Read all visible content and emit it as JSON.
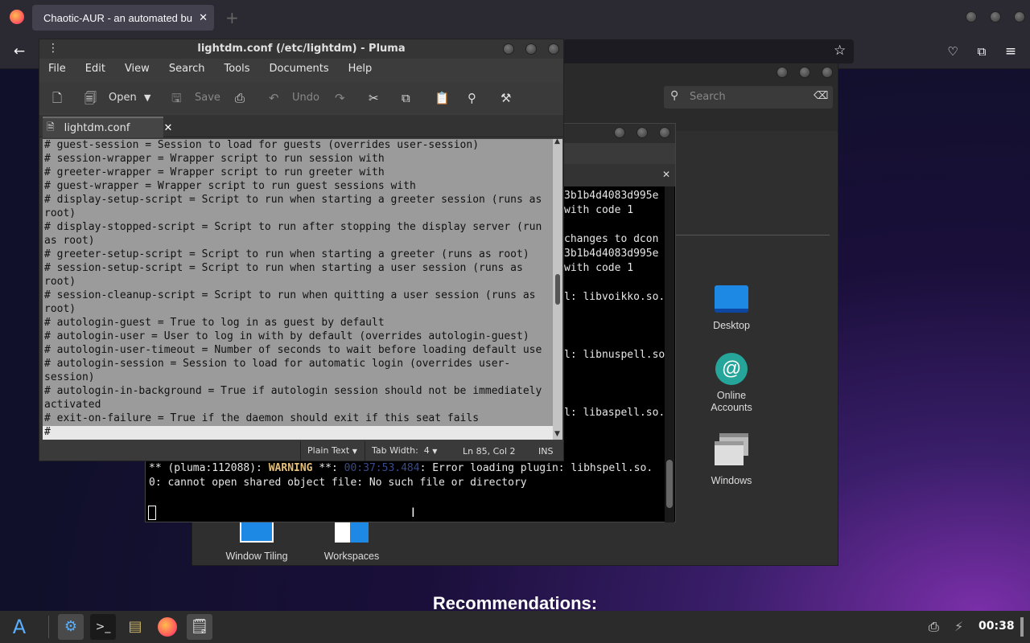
{
  "firefox": {
    "tab_title": "Chaotic-AUR - an automated bu",
    "close_tab": "✕",
    "new_tab": "+",
    "back": "←",
    "menu": "≡"
  },
  "welcome": {
    "search_placeholder": "Search",
    "icons": [
      {
        "label": "Desktop"
      },
      {
        "label": "Online\nAccounts"
      },
      {
        "label": "Windows"
      },
      {
        "label": "Window Tiling"
      },
      {
        "label": "Workspaces"
      }
    ]
  },
  "page": {
    "recommendations": "Recommendations:"
  },
  "terminal": {
    "lines": [
      "3b1b4d4083d995e",
      "with code 1",
      "",
      "changes to dcon",
      "3b1b4d4083d995e",
      "with code 1",
      "",
      "l: libvoikko.so.",
      "",
      "",
      "",
      "l: libnuspell.so",
      "",
      "",
      "",
      "l: libaspell.so."
    ],
    "warn_prefix": "** (pluma:112088): ",
    "warn_word": "WARNING",
    "warn_mid": " **: ",
    "warn_time": "00:37:53.484",
    "warn_rest": ": Error loading plugin: libhspell.so.",
    "warn_line2": "0: cannot open shared object file: No such file or directory"
  },
  "pluma": {
    "title": "lightdm.conf (/etc/lightdm) - Pluma",
    "menu": [
      "File",
      "Edit",
      "View",
      "Search",
      "Tools",
      "Documents",
      "Help"
    ],
    "toolbar": {
      "open": "Open",
      "save": "Save",
      "undo": "Undo"
    },
    "doc_tab": "lightdm.conf",
    "lines": [
      "# guest-session = Session to load for guests (overrides user-session)",
      "# session-wrapper = Wrapper script to run session with",
      "# greeter-wrapper = Wrapper script to run greeter with",
      "# guest-wrapper = Wrapper script to run guest sessions with",
      "# display-setup-script = Script to run when starting a greeter session (runs as",
      "root)",
      "# display-stopped-script = Script to run after stopping the display server (run",
      "as root)",
      "# greeter-setup-script = Script to run when starting a greeter (runs as root)",
      "# session-setup-script = Script to run when starting a user session (runs as",
      "root)",
      "# session-cleanup-script = Script to run when quitting a user session (runs as",
      "root)",
      "# autologin-guest = True to log in as guest by default",
      "# autologin-user = User to log in with by default (overrides autologin-guest)",
      "# autologin-user-timeout = Number of seconds to wait before loading default use",
      "# autologin-session = Session to load for automatic login (overrides user-",
      "session)",
      "# autologin-in-background = True if autologin session should not be immediately",
      "activated",
      "# exit-on-failure = True if the daemon should exit if this seat fails",
      "#"
    ],
    "status": {
      "syntax": "Plain Text",
      "tab_width": "Tab Width:  4",
      "position": "Ln 85, Col 2",
      "mode": "INS"
    }
  },
  "taskbar": {
    "clock": "00:38"
  }
}
